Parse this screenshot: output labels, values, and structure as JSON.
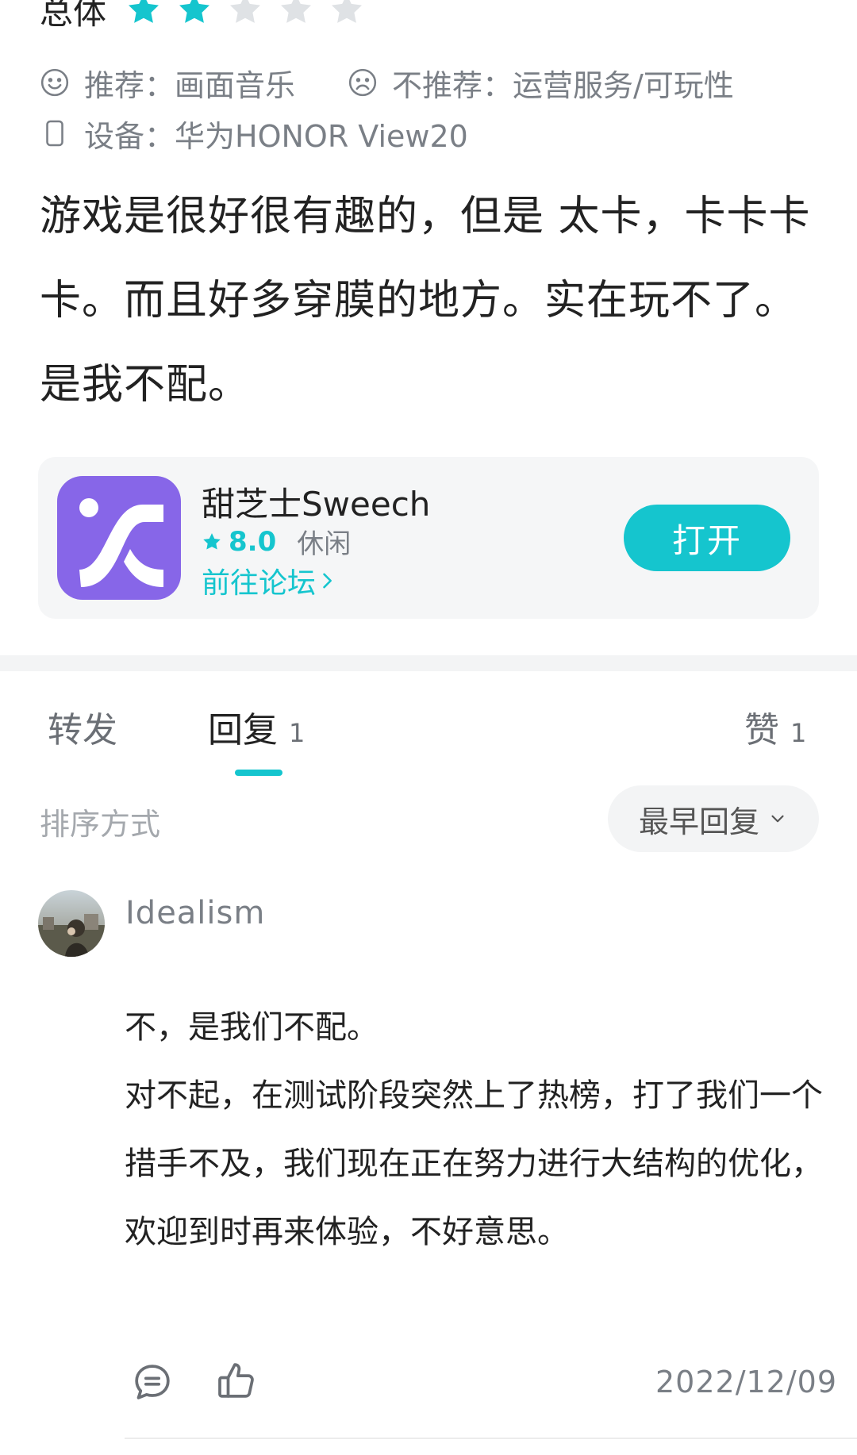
{
  "review": {
    "overall_label": "总体",
    "rating": 2,
    "max_rating": 5,
    "recommend": "推荐：画面音乐",
    "not_recommend": "不推荐：运营服务/可玩性",
    "device": "设备：华为HONOR View20",
    "text": "游戏是很好很有趣的，但是 太卡，卡卡卡卡。而且好多穿膜的地方。实在玩不了。是我不配。"
  },
  "app_card": {
    "name": "甜芝士Sweech",
    "rating": "8.0",
    "category": "休闲",
    "forum_link": "前往论坛",
    "open_button": "打开",
    "icon_color": "#8766e8"
  },
  "tabs": [
    {
      "label": "转发",
      "count": ""
    },
    {
      "label": "回复",
      "count": "1"
    },
    {
      "label": "赞",
      "count": "1"
    }
  ],
  "sort": {
    "label": "排序方式",
    "selected": "最早回复"
  },
  "reply": {
    "username": "Idealism",
    "paragraphs": [
      "不，是我们不配。",
      "对不起，在测试阶段突然上了热榜，打了我们一个措手不及，我们现在正在努力进行大结构的优化，欢迎到时再来体验，不好意思。"
    ],
    "date": "2022/12/09"
  },
  "colors": {
    "accent": "#15c5ce",
    "star_filled": "#15c5ce",
    "star_empty": "#dfe2e5",
    "muted_text": "#7a7f86"
  },
  "icons": {
    "star": "star-icon",
    "recommend": "smile-icon",
    "not_recommend": "frown-icon",
    "device": "phone-icon",
    "comment": "comment-icon",
    "like": "thumbs-up-icon"
  }
}
